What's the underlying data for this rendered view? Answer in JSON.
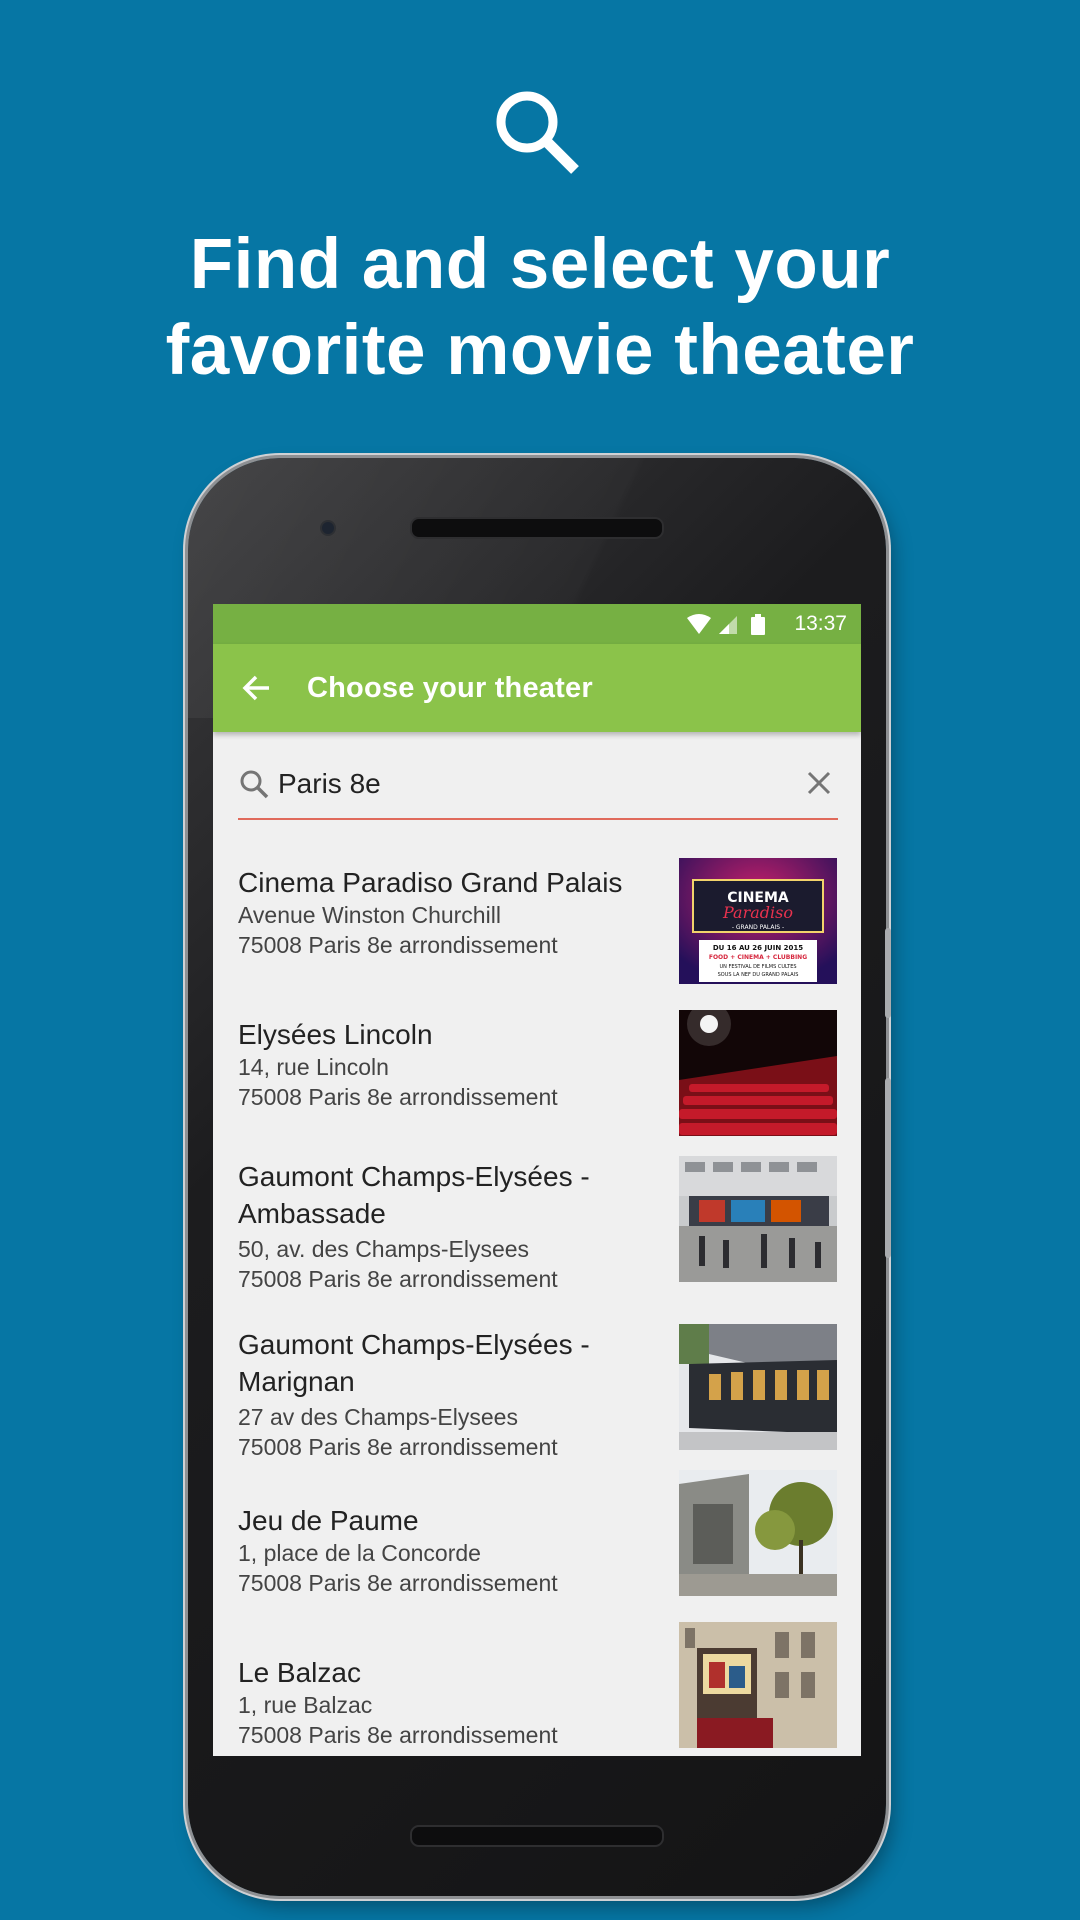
{
  "headline": {
    "line1": "Find and select your",
    "line2": "favorite movie theater"
  },
  "status_bar": {
    "time": "13:37"
  },
  "app_bar": {
    "title": "Choose your theater"
  },
  "search": {
    "value": "Paris 8e"
  },
  "theaters": [
    {
      "name": "Cinema Paradiso Grand Palais",
      "street": "Avenue Winston Churchill",
      "city": "75008 Paris 8e arrondissement"
    },
    {
      "name": "Elysées Lincoln",
      "street": "14, rue Lincoln",
      "city": "75008 Paris 8e arrondissement"
    },
    {
      "name_line1": "Gaumont Champs-Elysées -",
      "name_line2": "Ambassade",
      "street": "50, av. des Champs-Elysees",
      "city": "75008 Paris 8e arrondissement"
    },
    {
      "name_line1": "Gaumont Champs-Elysées -",
      "name_line2": "Marignan",
      "street": "27 av des Champs-Elysees",
      "city": "75008 Paris 8e arrondissement"
    },
    {
      "name": "Jeu de Paume",
      "street": "1, place de la Concorde",
      "city": "75008 Paris 8e arrondissement"
    },
    {
      "name": "Le Balzac",
      "street": "1, rue Balzac",
      "city": "75008 Paris 8e arrondissement"
    }
  ],
  "poster_text": {
    "word1": "CINEMA",
    "word2": "Paradiso",
    "word3": "- GRAND PALAIS -",
    "dates": "DU 16 AU 26 JUIN 2015",
    "tagline": "FOOD + CINEMA + CLUBBING",
    "festival": "UN FESTIVAL DE FILMS CULTES",
    "venue": "SOUS LA NEF DU GRAND PALAIS"
  },
  "colors": {
    "background": "#0676a4",
    "status_bar": "#76b043",
    "app_bar": "#8bc34a",
    "search_underline": "#e06a5b"
  },
  "icons": {
    "hero": "search-icon",
    "back": "arrow-back-icon",
    "search": "search-icon",
    "clear": "close-icon",
    "wifi": "wifi-icon",
    "signal": "signal-icon",
    "battery": "battery-icon"
  }
}
